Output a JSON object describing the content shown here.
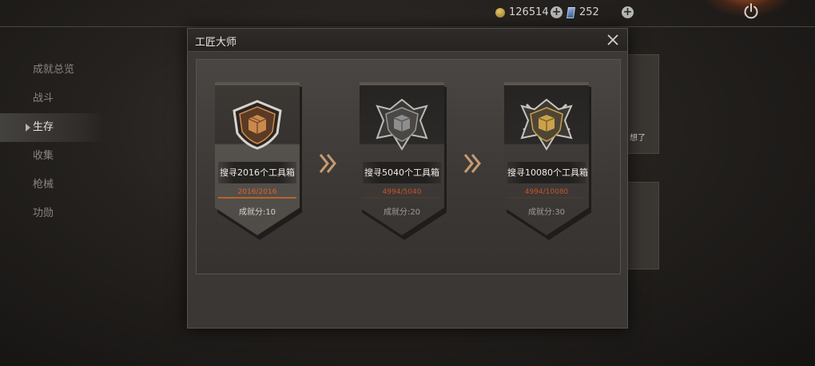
{
  "topbar": {
    "coins": "126514",
    "cards": "252"
  },
  "nav": {
    "items": [
      {
        "label": "成就总览",
        "active": false
      },
      {
        "label": "战斗",
        "active": false
      },
      {
        "label": "生存",
        "active": true
      },
      {
        "label": "收集",
        "active": false
      },
      {
        "label": "枪械",
        "active": false
      },
      {
        "label": "功勋",
        "active": false
      }
    ]
  },
  "background": {
    "partial_text": "想了"
  },
  "modal": {
    "title": "工匠大师",
    "achievements": [
      {
        "task": "搜寻2016个工具箱",
        "progress": "2016/2016",
        "score": "成就分:10",
        "tier": "bronze",
        "completed": true
      },
      {
        "task": "搜寻5040个工具箱",
        "progress": "4994/5040",
        "score": "成就分:20",
        "tier": "silver",
        "completed": false
      },
      {
        "task": "搜寻10080个工具箱",
        "progress": "4994/10080",
        "score": "成就分:30",
        "tier": "gold",
        "completed": false
      }
    ]
  },
  "colors": {
    "accent_orange": "#e3602e",
    "bronze": "#c98a4c",
    "silver": "#9a9a9a",
    "gold": "#c9a24a"
  },
  "icons": [
    "coin-icon",
    "card-icon",
    "plus-icon",
    "power-icon",
    "close-icon",
    "crate-emblem-icon",
    "chevron-right-icon"
  ]
}
